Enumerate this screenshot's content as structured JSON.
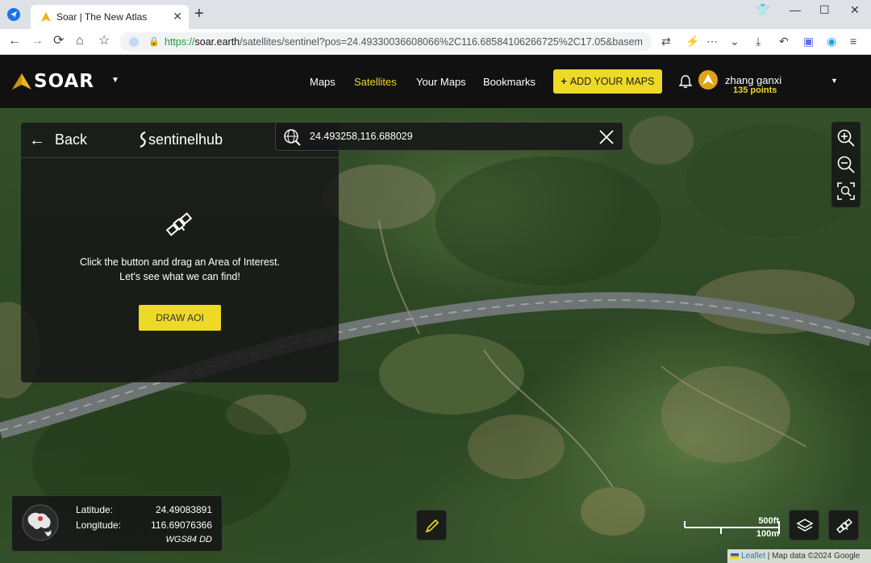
{
  "browser": {
    "tab_title": "Soar | The New Atlas",
    "tab_close": "✕",
    "new_tab": "+",
    "url_scheme": "https://",
    "url_host": "soar.earth",
    "url_rest": "/satellites/sentinel?pos=24.49330036608066%2C116.68584106266725%2C17.05&basem"
  },
  "header": {
    "brand": "SOAR",
    "nav": [
      "Maps",
      "Satellites",
      "Your Maps",
      "Bookmarks"
    ],
    "active_nav": "Satellites",
    "add_button": "ADD YOUR MAPS",
    "user_name": "zhang ganxi",
    "user_points": "135 points",
    "accent_color": "#eed926"
  },
  "panel": {
    "back_label": "Back",
    "provider_logo": "sentinelhub",
    "message_line1": "Click the button and drag an Area of Interest.",
    "message_line2": "Let's see what we can find!",
    "draw_button": "DRAW AOI"
  },
  "search": {
    "value": "24.493258,116.688029"
  },
  "coords": {
    "latitude_label": "Latitude:",
    "latitude_value": "24.49083891",
    "longitude_label": "Longitude:",
    "longitude_value": "116.69076366",
    "system": "WGS84 DD"
  },
  "scale": {
    "feet": "500ft",
    "meters": "100m"
  },
  "attribution": {
    "leaflet": "Leaflet",
    "rest": " | Map data ©2024 Google"
  }
}
